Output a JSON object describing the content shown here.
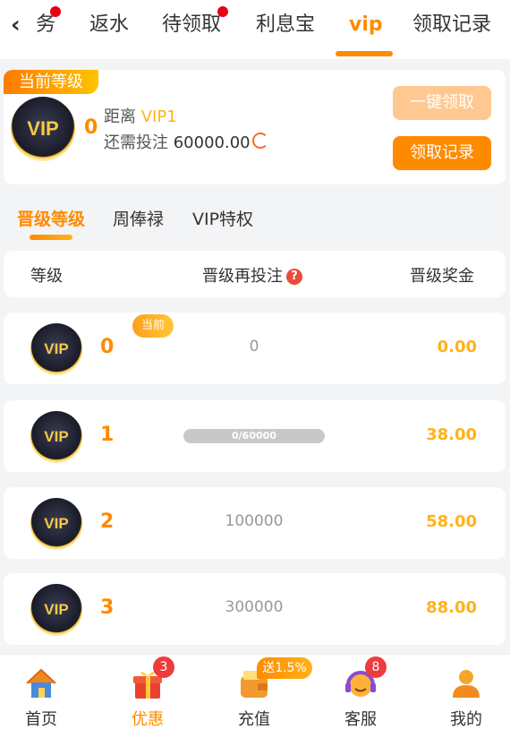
{
  "top_tabs": [
    {
      "label": "务",
      "dot": true
    },
    {
      "label": "返水",
      "dot": false
    },
    {
      "label": "待领取",
      "dot": true
    },
    {
      "label": "利息宝",
      "dot": false
    },
    {
      "label": "vip",
      "dot": false,
      "active": true
    },
    {
      "label": "领取记录",
      "dot": false
    }
  ],
  "level_card": {
    "tag": "当前等级",
    "badge_text": "VIP",
    "current_level": "0",
    "distance_prefix": "距离",
    "next_level": "VIP1",
    "need_prefix": "还需投注",
    "need_amount": "60000.00",
    "claim_all_label": "一键领取",
    "record_label": "领取记录"
  },
  "sub_tabs": [
    {
      "label": "晋级等级",
      "active": true
    },
    {
      "label": "周俸禄",
      "active": false
    },
    {
      "label": "VIP特权",
      "active": false
    }
  ],
  "table": {
    "headers": {
      "level": "等级",
      "bet": "晋级再投注",
      "bonus": "晋级奖金"
    },
    "current_pill": "当前",
    "rows": [
      {
        "badge": "VIP",
        "level": "0",
        "bet": "0",
        "bonus": "0.00",
        "is_current": true
      },
      {
        "badge": "VIP",
        "level": "1",
        "bet": "0/60000",
        "bonus": "38.00",
        "progress": 0
      },
      {
        "badge": "VIP",
        "level": "2",
        "bet": "100000",
        "bonus": "58.00"
      },
      {
        "badge": "VIP",
        "level": "3",
        "bet": "300000",
        "bonus": "88.00"
      }
    ]
  },
  "bottom_nav": [
    {
      "label": "首页",
      "icon": "home-icon"
    },
    {
      "label": "优惠",
      "icon": "gift-icon",
      "badge": "3",
      "active": true
    },
    {
      "label": "充值",
      "icon": "wallet-icon",
      "promo": "送1.5%"
    },
    {
      "label": "客服",
      "icon": "headset-icon",
      "badge": "8"
    },
    {
      "label": "我的",
      "icon": "user-icon"
    }
  ],
  "colors": {
    "accent": "#ff8a00",
    "gold": "#ffb21a",
    "red": "#e60012"
  }
}
